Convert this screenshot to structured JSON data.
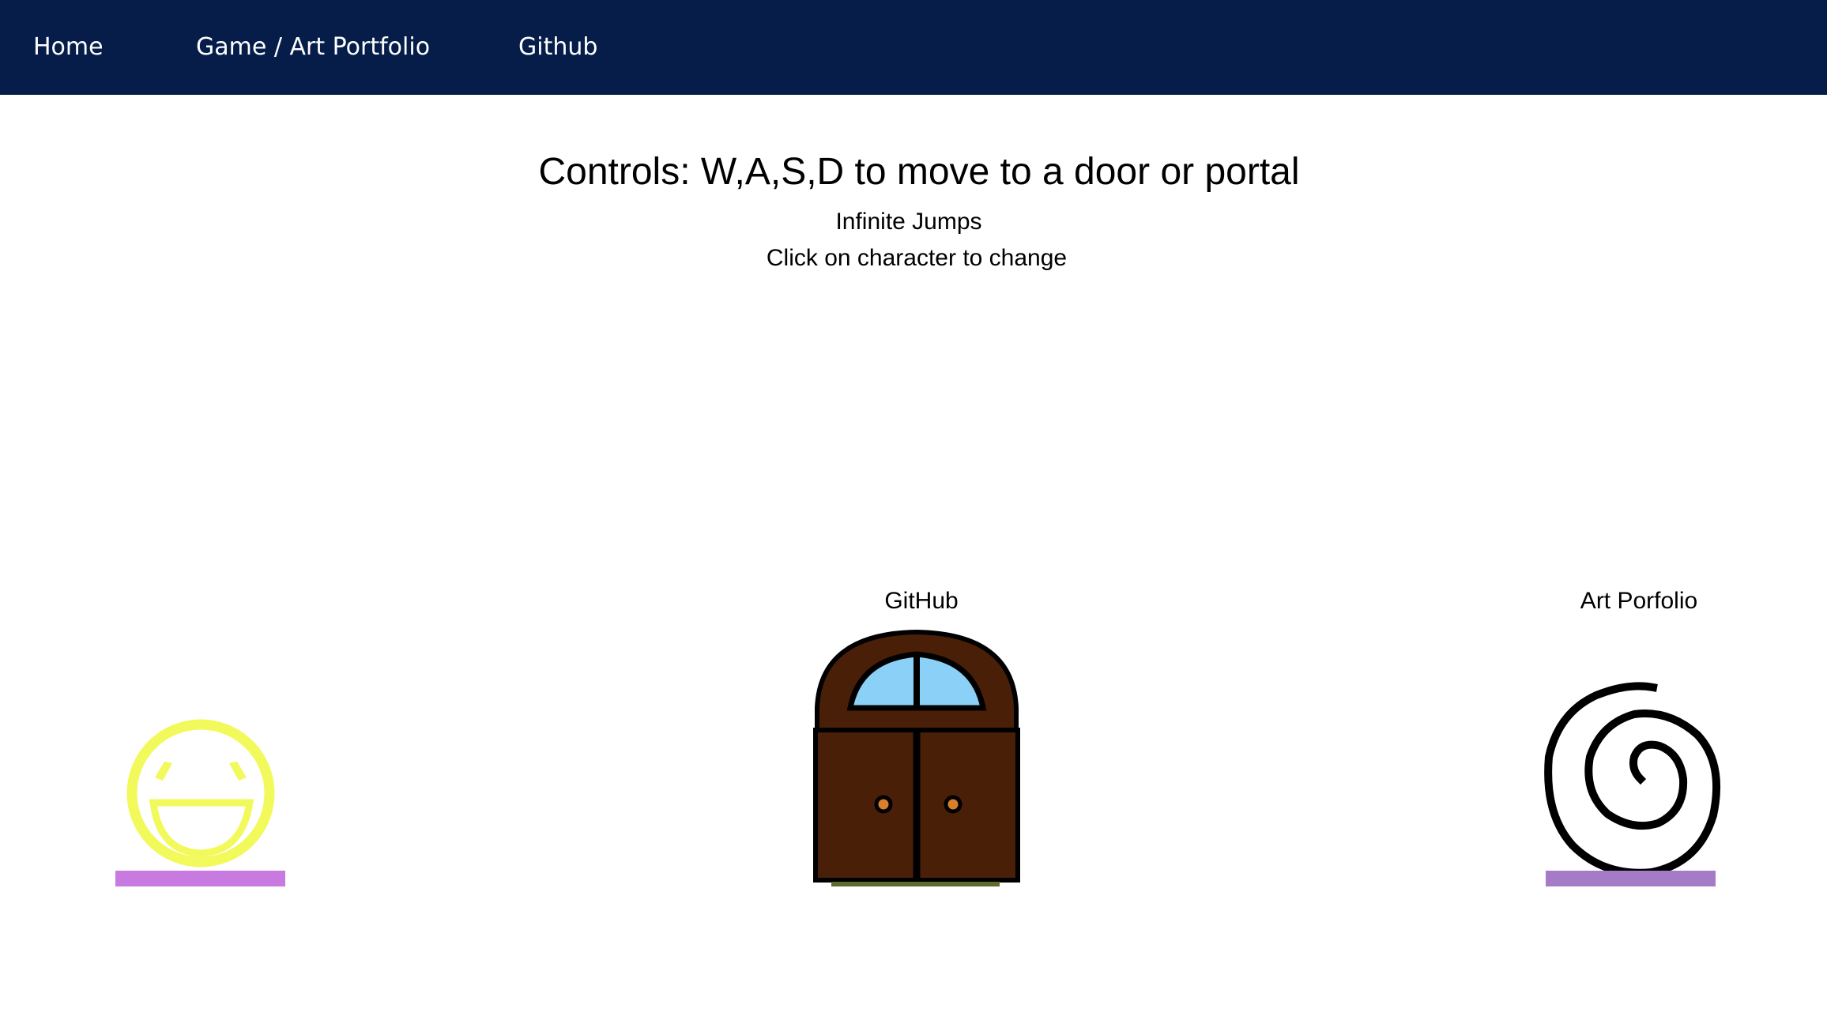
{
  "nav": {
    "home": "Home",
    "portfolio": "Game / Art Portfolio",
    "github": "Github"
  },
  "instructions": {
    "heading": "Controls: W,A,S,D to move to a door or portal",
    "jumps": "Infinite Jumps",
    "character_hint": "Click on character to change"
  },
  "game": {
    "door_label": "GitHub",
    "portal_label": "Art Porfolio"
  },
  "colors": {
    "navbar": "#061d49",
    "character": "#f2f95a",
    "character_platform": "#c97ae0",
    "door_wood": "#4a1f08",
    "door_window": "#8ad0f7",
    "portal_platform": "#a57ac7"
  },
  "icons": {
    "character": "smiley-face-icon",
    "door": "double-door-icon",
    "portal": "spiral-portal-icon"
  }
}
